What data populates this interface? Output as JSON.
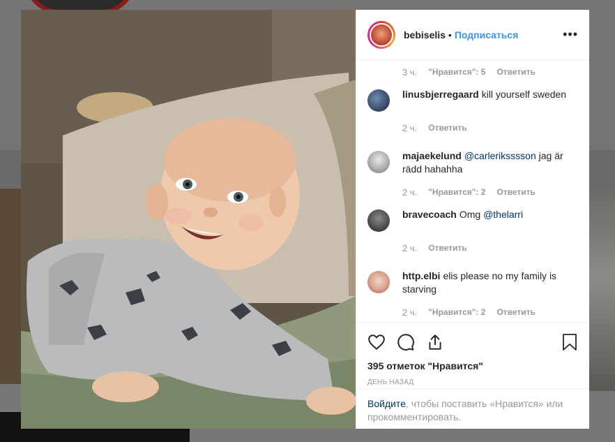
{
  "post": {
    "username": "bebiselis",
    "separator": "•",
    "follow_label": "Подписаться",
    "more_label": "•••",
    "likes_text": "395 отметок \"Нравится\"",
    "posted_text": "день назад"
  },
  "comments": {
    "first_meta": {
      "time": "3 ч.",
      "likes": "\"Нравится\": 5",
      "reply": "Ответить"
    },
    "items": [
      {
        "user": "linusbjerregaard",
        "text": "kill yourself sweden",
        "mention": "",
        "after": "",
        "time": "2 ч.",
        "likes": "",
        "reply": "Ответить"
      },
      {
        "user": "majaekelund",
        "text": "",
        "mention": "@carleriksssson",
        "after": " jag är rädd hahahha",
        "time": "2 ч.",
        "likes": "\"Нравится\": 2",
        "reply": "Ответить"
      },
      {
        "user": "bravecoach",
        "text": "Omg ",
        "mention": "@thelarri",
        "after": "",
        "time": "2 ч.",
        "likes": "",
        "reply": "Ответить"
      },
      {
        "user": "http.elbi",
        "text": "elis please no my family is starving",
        "mention": "",
        "after": "",
        "time": "2 ч.",
        "likes": "\"Нравится\": 2",
        "reply": "Ответить"
      }
    ]
  },
  "login_prompt": {
    "link": "Войдите",
    "text": ", чтобы поставить «Нравится» или прокомментировать."
  },
  "icons": {
    "like": "heart-icon",
    "comment": "comment-icon",
    "share": "share-icon",
    "save": "bookmark-icon",
    "more": "more-icon"
  },
  "colors": {
    "link": "#3897f0",
    "mention": "#003569",
    "text": "#262626",
    "muted": "#999999",
    "border": "#efefef"
  }
}
